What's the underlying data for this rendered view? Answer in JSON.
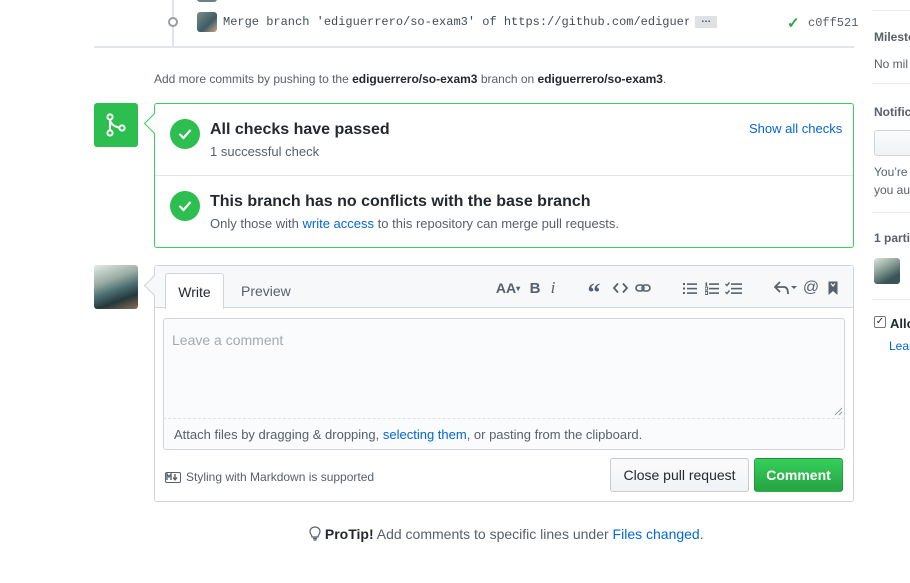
{
  "commit": {
    "message": "Merge branch 'ediguerrero/so-exam3' of https://github.com/ediguerrero…",
    "ellipsis": "…",
    "sha": "c0ff521"
  },
  "push_hint": {
    "prefix": "Add more commits by pushing to the ",
    "branch": "ediguerrero/so-exam3",
    "middle": " branch on ",
    "repo": "ediguerrero/so-exam3",
    "suffix": "."
  },
  "checks": {
    "title": "All checks have passed",
    "subtitle": "1 successful check",
    "show_all": "Show all checks"
  },
  "conflicts": {
    "title": "This branch has no conflicts with the base branch",
    "sub_prefix": "Only those with ",
    "sub_link": "write access",
    "sub_suffix": " to this repository can merge pull requests."
  },
  "comment_form": {
    "tab_write": "Write",
    "tab_preview": "Preview",
    "placeholder": "Leave a comment",
    "attach_prefix": "Attach files by dragging & dropping, ",
    "attach_link": "selecting them",
    "attach_suffix": ", or pasting from the clipboard.",
    "markdown_note": "Styling with Markdown is supported",
    "close_button": "Close pull request",
    "comment_button": "Comment",
    "toolbar_heading": "AA",
    "toolbar_bold": "B",
    "toolbar_italic": "i",
    "toolbar_quote": "“",
    "toolbar_mention": "@"
  },
  "protip": {
    "label": "ProTip!",
    "text": " Add comments to specific lines under ",
    "link": "Files changed",
    "suffix": "."
  },
  "sidebar": {
    "milestone_head": "Milesto",
    "milestone_text": "No mil",
    "notif_head": "Notific",
    "notif_text1": "You’re",
    "notif_text2": "you au",
    "participants_head": "1 parti",
    "allow_label": "Allo",
    "learn_link": "Lear"
  },
  "colors": {
    "success": "#2cbe4e",
    "link": "#0366d6",
    "border_green": "#34d058"
  }
}
